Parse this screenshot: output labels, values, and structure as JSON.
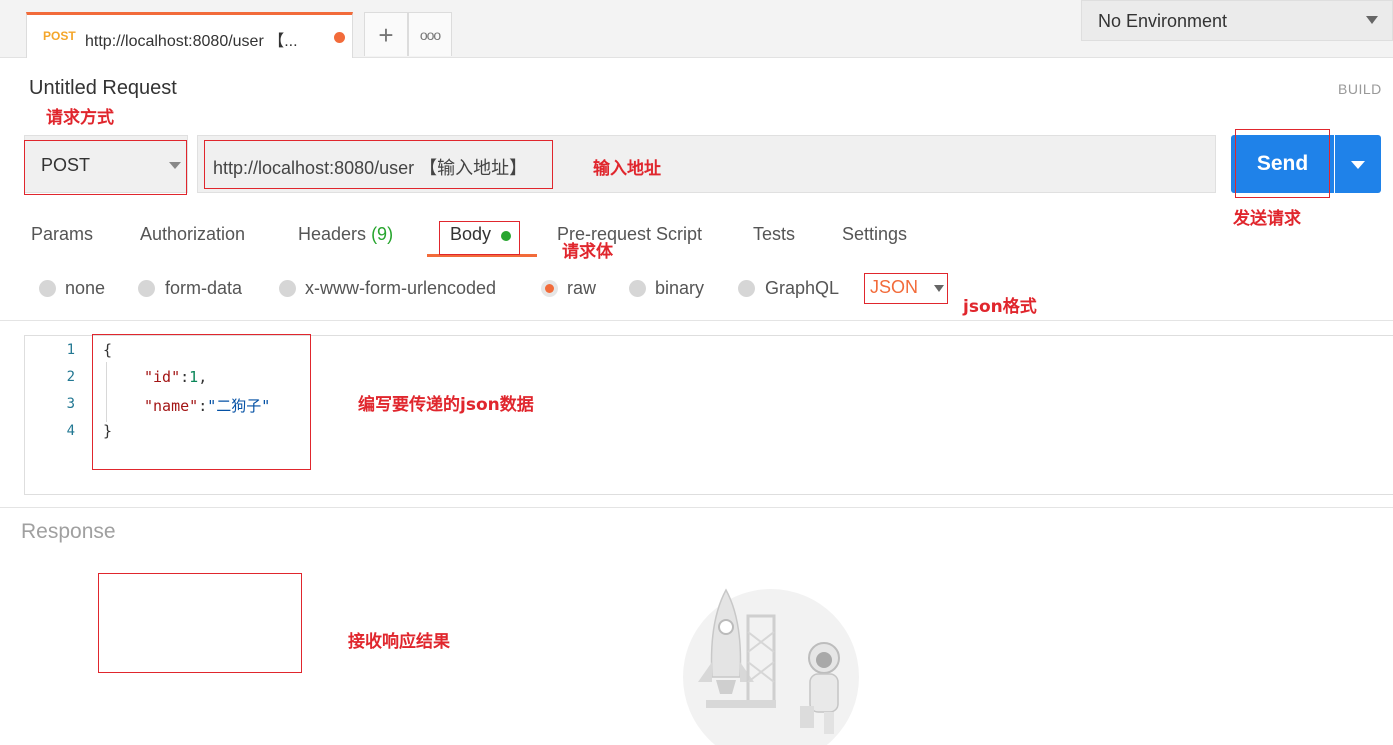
{
  "tabs": {
    "active": {
      "method": "POST",
      "title": "http://localhost:8080/user 【..."
    },
    "add_label": "+",
    "more_label": "ooo"
  },
  "environment": {
    "selected": "No Environment"
  },
  "request": {
    "name": "Untitled Request",
    "build_label": "BUILD",
    "method": "POST",
    "url": "http://localhost:8080/user 【输入地址】",
    "send_label": "Send"
  },
  "request_tabs": [
    {
      "label": "Params"
    },
    {
      "label": "Authorization"
    },
    {
      "label": "Headers",
      "count": "(9)"
    },
    {
      "label": "Body",
      "active": true
    },
    {
      "label": "Pre-request Script"
    },
    {
      "label": "Tests"
    },
    {
      "label": "Settings"
    }
  ],
  "body_modes": [
    {
      "label": "none"
    },
    {
      "label": "form-data"
    },
    {
      "label": "x-www-form-urlencoded"
    },
    {
      "label": "raw",
      "selected": true
    },
    {
      "label": "binary"
    },
    {
      "label": "GraphQL"
    }
  ],
  "format": {
    "selected": "JSON"
  },
  "editor": {
    "line_numbers": [
      "1",
      "2",
      "3",
      "4"
    ],
    "lines": {
      "l1": "{",
      "l2_key": "\"id\"",
      "l2_colon": ":",
      "l2_val": "1",
      "l2_comma": ",",
      "l3_key": "\"name\"",
      "l3_colon": ":",
      "l3_val": "\"二狗子\"",
      "l4": "}"
    }
  },
  "response": {
    "label": "Response"
  },
  "annotations": {
    "method": "请求方式",
    "url": "输入地址",
    "send": "发送请求",
    "body": "请求体",
    "json": "json格式",
    "editor": "编写要传递的json数据",
    "response": "接收响应结果"
  },
  "colors": {
    "accent": "#f26b3a",
    "send": "#1f82e9",
    "annotation": "#e0262d",
    "active_dot": "#27a52e"
  }
}
